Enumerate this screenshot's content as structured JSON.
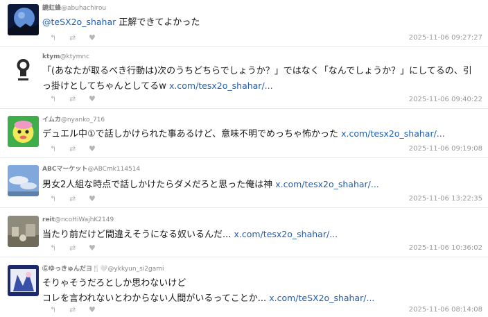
{
  "tweets": [
    {
      "name": "鏡虹蜂",
      "handle": "@abuhachirou",
      "mention": "@teSX2o_shahar",
      "line1": " 正解できてよかった",
      "line2": "",
      "link": "",
      "timestamp": "2025-11-06 09:27:27"
    },
    {
      "name": "ktym",
      "handle": "@ktymnc",
      "mention": "",
      "line1": "「(あなたが取るべき行動は)次のうちどちらでしょうか？」ではなく「なんでしょうか？」にしてるの、引",
      "line2": "っ掛けとしてちゃんとしてるw ",
      "link": "x.com/tesx2o_shahar/...",
      "timestamp": "2025-11-06 09:40:22"
    },
    {
      "name": "イムカ",
      "handle": "@nyanko_716",
      "mention": "",
      "line1": "デュエル中①で話しかけられた事あるけど、意味不明でめっちゃ怖かった ",
      "line2": "",
      "link": "x.com/tesx2o_shahar/...",
      "timestamp": "2025-11-06 09:19:08"
    },
    {
      "name": "ABCマーケット",
      "handle": "@ABCmk114514",
      "mention": "",
      "line1": "男女2人組な時点で話しかけたらダメだろと思った俺は神 ",
      "line2": "",
      "link": "x.com/tesx2o_shahar/...",
      "timestamp": "2025-11-06 13:22:35"
    },
    {
      "name": "reit",
      "handle": "@ncoHiWajhK2149",
      "mention": "",
      "line1": "当たり前だけど間違えそうになる奴いるんだ... ",
      "line2": "",
      "link": "x.com/tesx2o_shahar/...",
      "timestamp": "2025-11-06 10:36:02"
    },
    {
      "name": "Ⓖゆっきゅんだヨ🍴🤍",
      "handle": "@ykkyun_si2gami",
      "mention": "",
      "line1": "そりゃそうだろとしか思わないけど",
      "line2": "コレを言われないとわからない人間がいるってことか... ",
      "link": "x.com/teSX2o_shahar/...",
      "timestamp": "2025-11-06 08:14:08"
    }
  ],
  "action_icons": {
    "reply": "↰",
    "retweet": "⇄",
    "like": "♥"
  },
  "colors": {
    "link": "#1f5fb3",
    "divider": "#e6e6e6",
    "meta": "#888888"
  }
}
